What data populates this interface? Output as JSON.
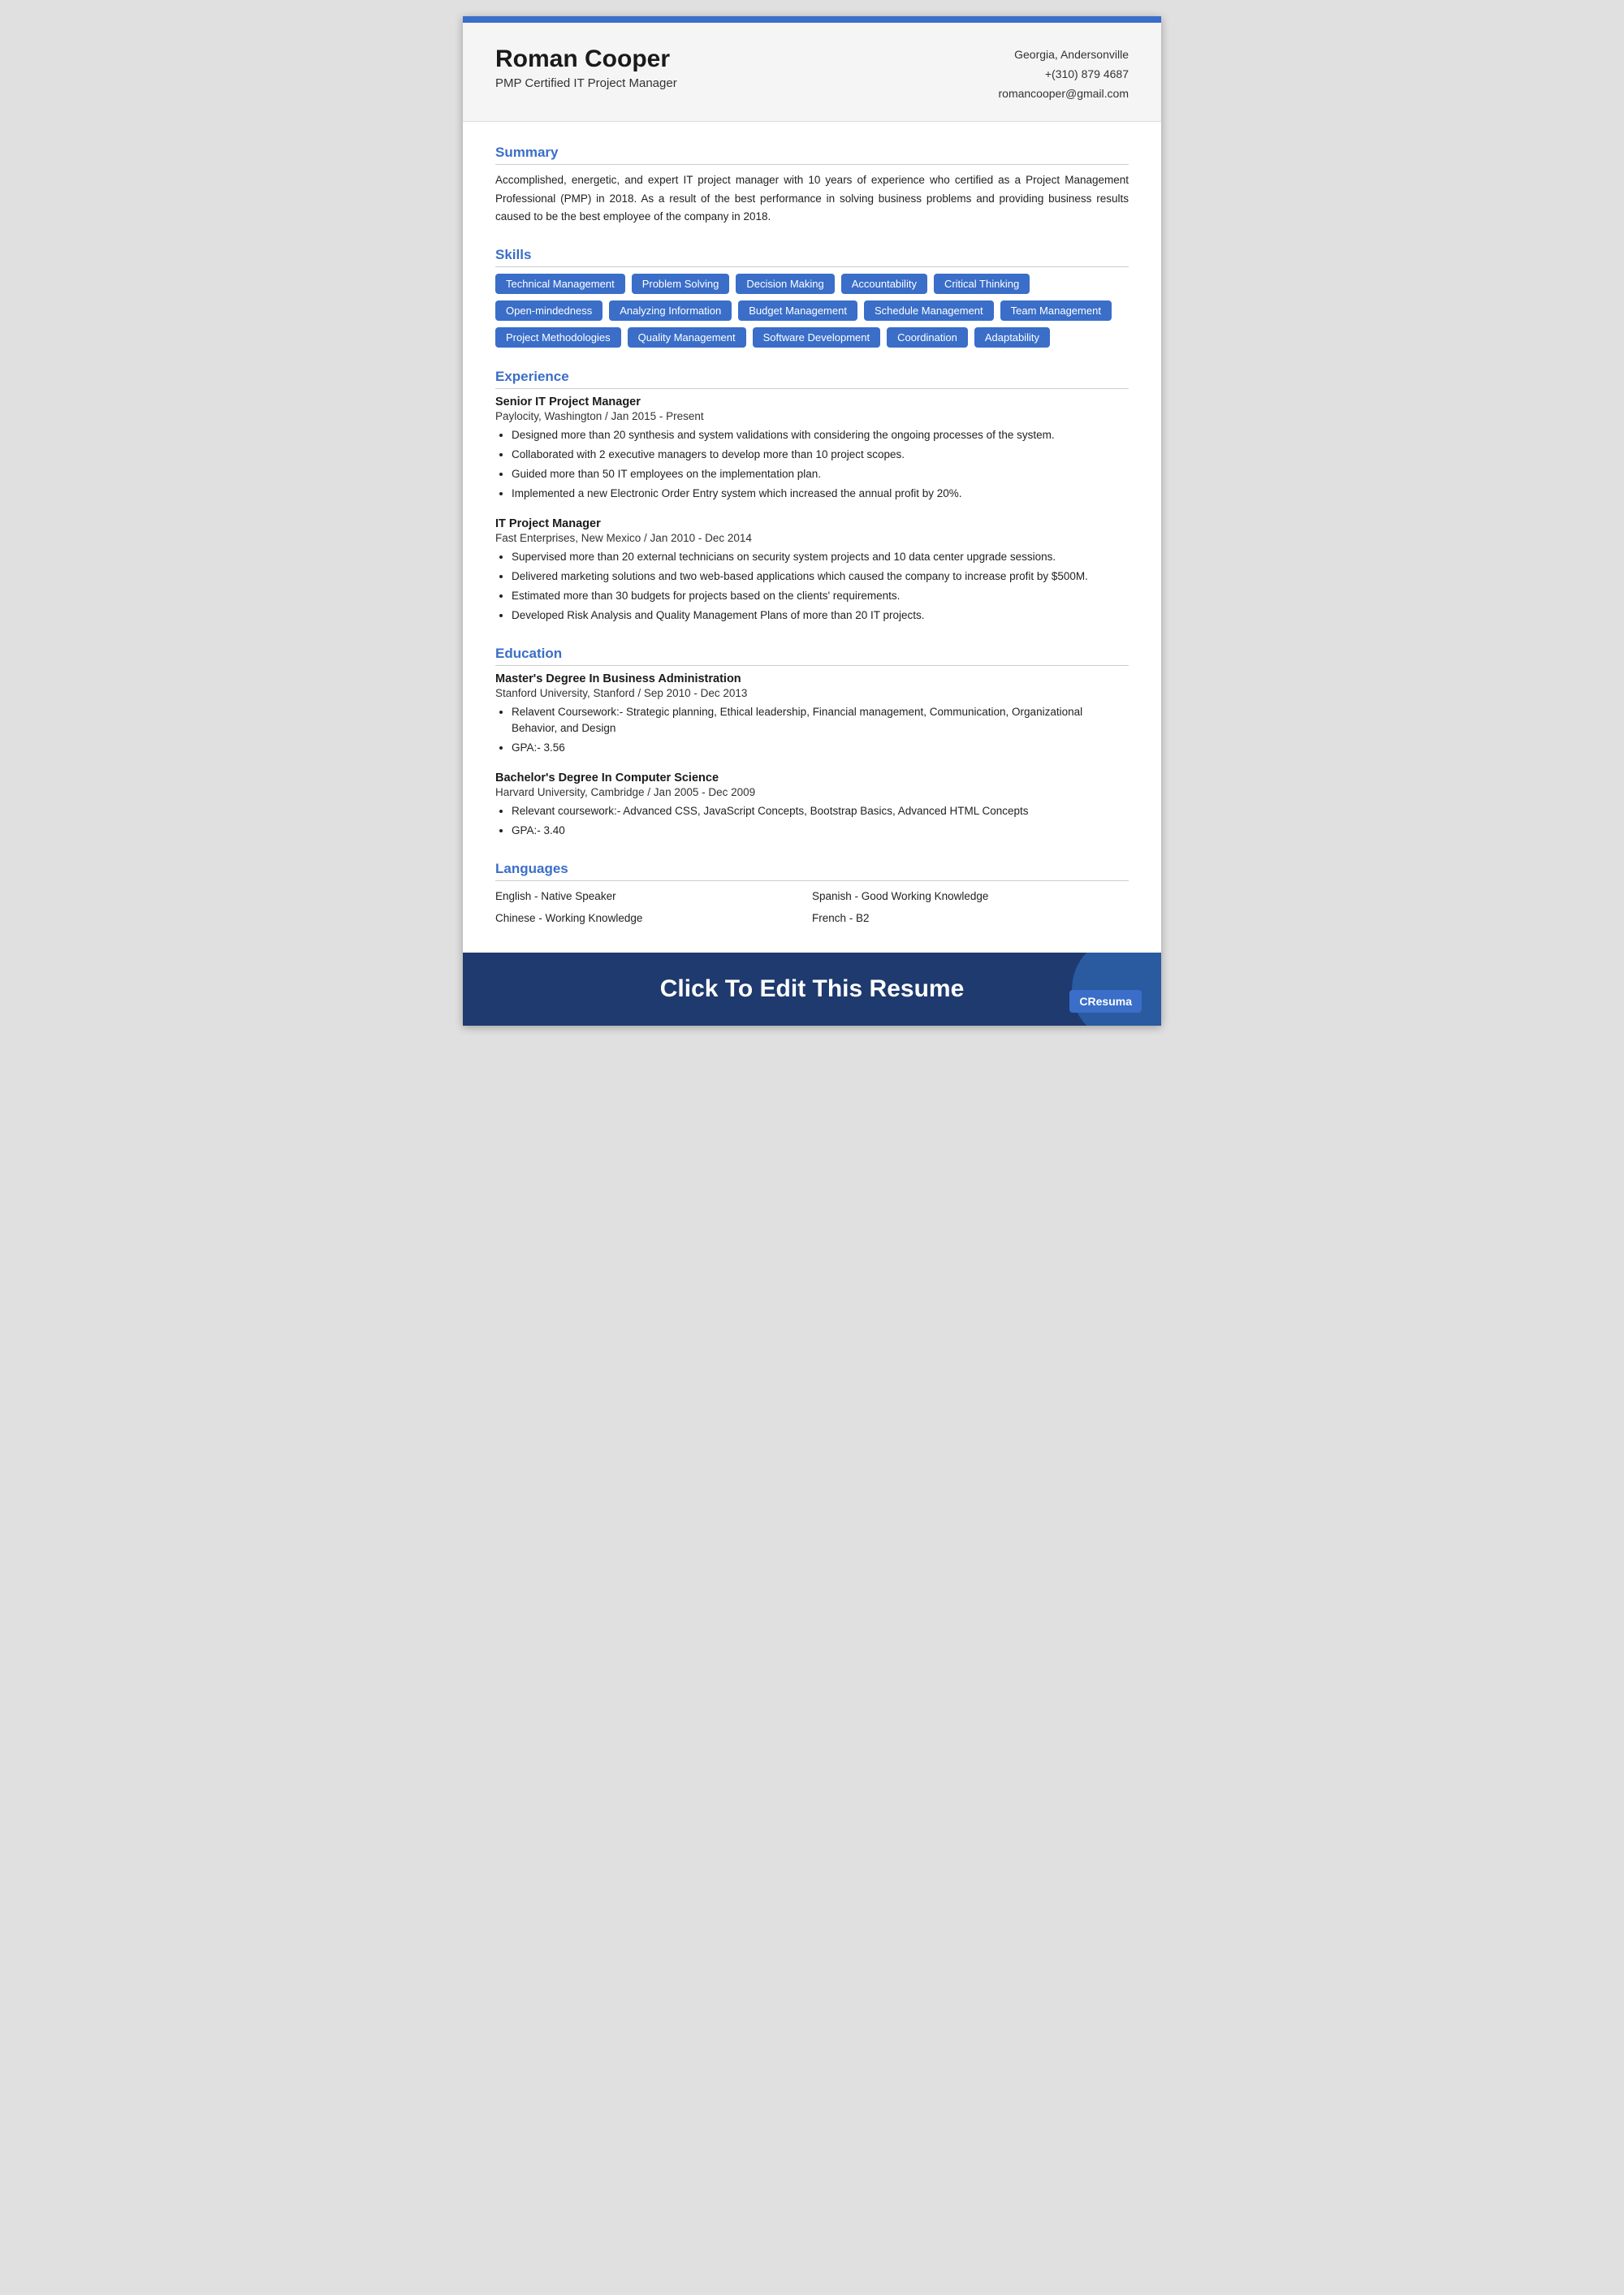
{
  "topbar": {},
  "header": {
    "name": "Roman Cooper",
    "title": "PMP Certified IT Project Manager",
    "location": "Georgia, Andersonville",
    "phone": "+(310) 879 4687",
    "email": "romancooper@gmail.com"
  },
  "summary": {
    "section_title": "Summary",
    "text": "Accomplished, energetic, and expert IT project manager with 10 years of experience who certified as a Project Management Professional (PMP) in 2018. As a result of the best performance in solving business problems and providing business results caused to be the best employee of the company in 2018."
  },
  "skills": {
    "section_title": "Skills",
    "items": [
      "Technical Management",
      "Problem Solving",
      "Decision Making",
      "Accountability",
      "Critical Thinking",
      "Open-mindedness",
      "Analyzing Information",
      "Budget Management",
      "Schedule Management",
      "Team Management",
      "Project Methodologies",
      "Quality Management",
      "Software Development",
      "Coordination",
      "Adaptability"
    ]
  },
  "experience": {
    "section_title": "Experience",
    "jobs": [
      {
        "title": "Senior IT Project Manager",
        "company": "Paylocity, Washington / Jan 2015 - Present",
        "bullets": [
          "Designed more than 20 synthesis and system validations with considering the ongoing processes of the system.",
          "Collaborated with 2 executive managers to develop more than 10 project scopes.",
          "Guided more than 50 IT employees on the implementation plan.",
          "Implemented a new Electronic Order Entry system which increased the annual profit by 20%."
        ]
      },
      {
        "title": "IT Project Manager",
        "company": "Fast Enterprises, New Mexico / Jan 2010 - Dec 2014",
        "bullets": [
          "Supervised more than 20 external technicians on security system projects and 10 data center upgrade sessions.",
          "Delivered marketing solutions and two web-based applications which caused the company to increase profit by $500M.",
          "Estimated more than 30 budgets for projects based on the clients' requirements.",
          "Developed Risk Analysis and Quality Management Plans of more than 20 IT projects."
        ]
      }
    ]
  },
  "education": {
    "section_title": "Education",
    "entries": [
      {
        "degree": "Master's Degree In Business Administration",
        "school": "Stanford University, Stanford / Sep 2010 - Dec 2013",
        "bullets": [
          "Relavent Coursework:- Strategic planning, Ethical leadership, Financial management, Communication, Organizational Behavior, and Design",
          "GPA:- 3.56"
        ]
      },
      {
        "degree": "Bachelor's Degree In Computer Science",
        "school": "Harvard University, Cambridge / Jan 2005 - Dec 2009",
        "bullets": [
          "Relevant coursework:- Advanced CSS, JavaScript Concepts,  Bootstrap Basics, Advanced HTML Concepts",
          "GPA:- 3.40"
        ]
      }
    ]
  },
  "languages": {
    "section_title": "Languages",
    "items": [
      {
        "name": "English - Native Speaker",
        "col": 1
      },
      {
        "name": "Spanish - Good Working Knowledge",
        "col": 2
      },
      {
        "name": "Chinese - Working Knowledge",
        "col": 1
      },
      {
        "name": "French - B2",
        "col": 2
      }
    ]
  },
  "footer": {
    "cta_text": "Click To Edit This Resume",
    "logo_text": "CResuma"
  }
}
